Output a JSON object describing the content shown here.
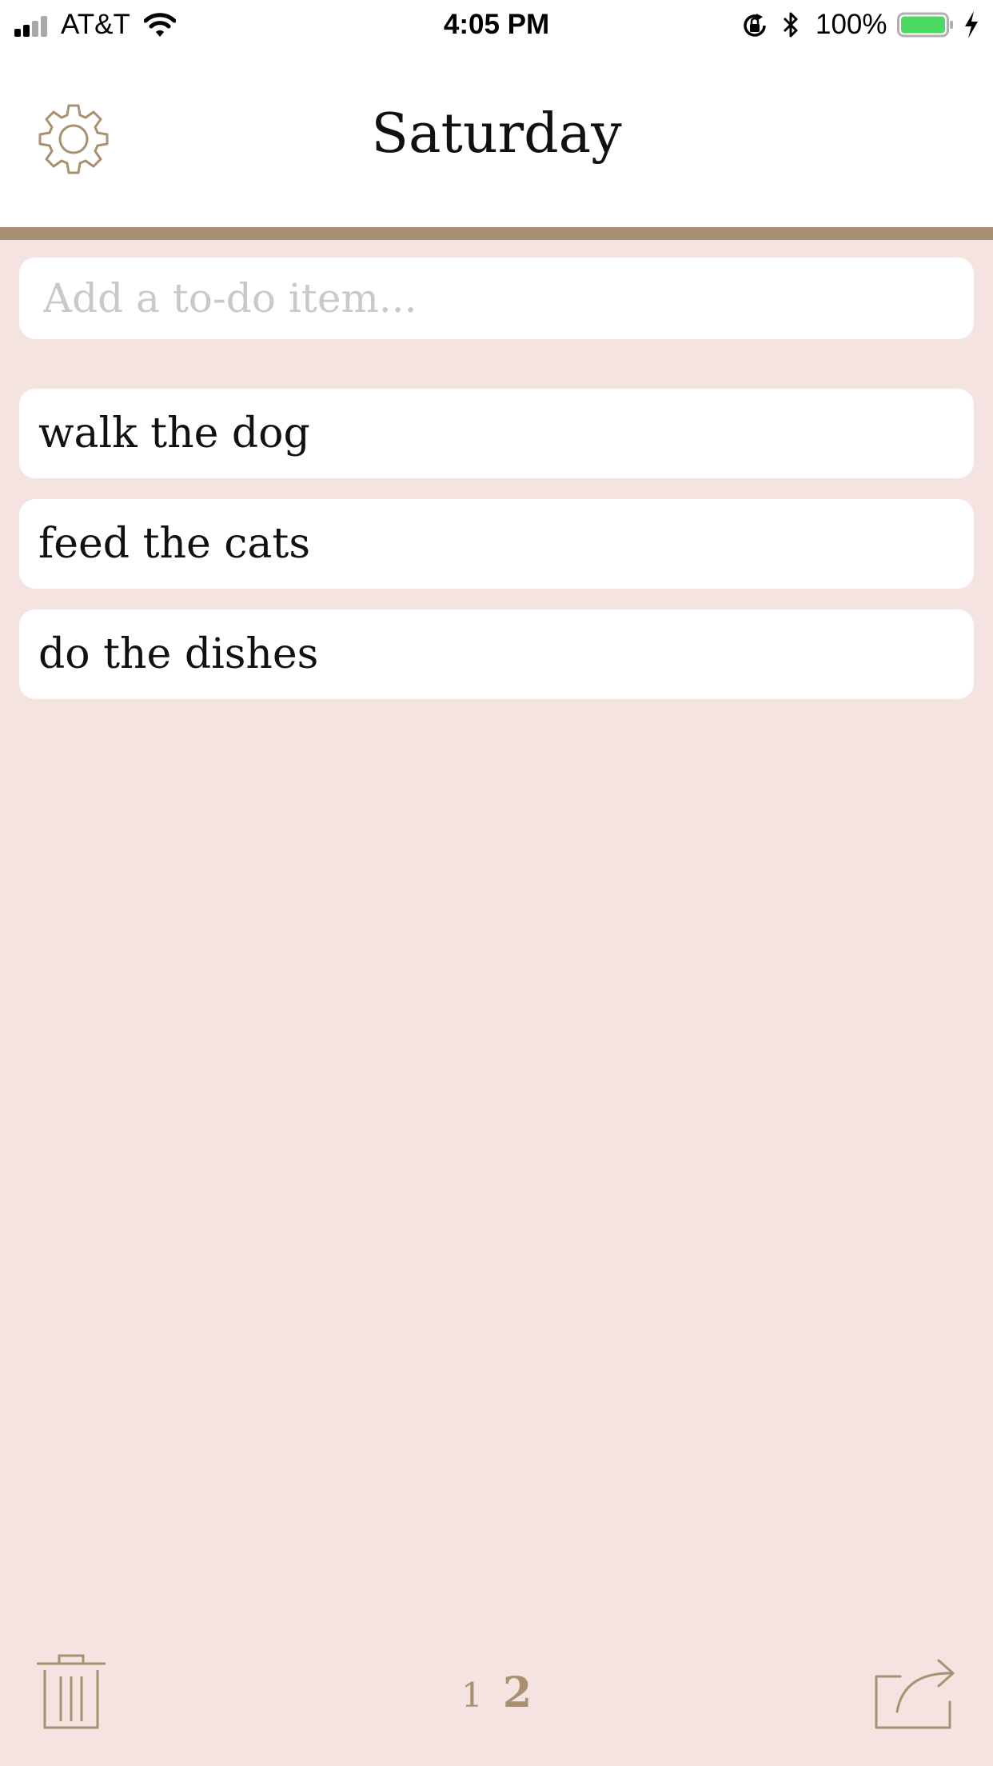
{
  "status_bar": {
    "carrier": "AT&T",
    "time": "4:05 PM",
    "battery": "100%"
  },
  "header": {
    "title": "Saturday",
    "settings_icon": "gear-icon"
  },
  "add_input": {
    "placeholder": "Add a to-do item...",
    "value": ""
  },
  "todos": [
    {
      "text": "walk the dog"
    },
    {
      "text": "feed the cats"
    },
    {
      "text": "do the dishes"
    }
  ],
  "toolbar": {
    "trash_icon": "trash-icon",
    "share_icon": "share-icon",
    "pages": [
      {
        "label": "1",
        "active": false
      },
      {
        "label": "2",
        "active": true
      }
    ]
  },
  "colors": {
    "accent": "#a89070",
    "background": "#f5e3e1",
    "card": "#ffffff",
    "battery": "#4cd964"
  }
}
